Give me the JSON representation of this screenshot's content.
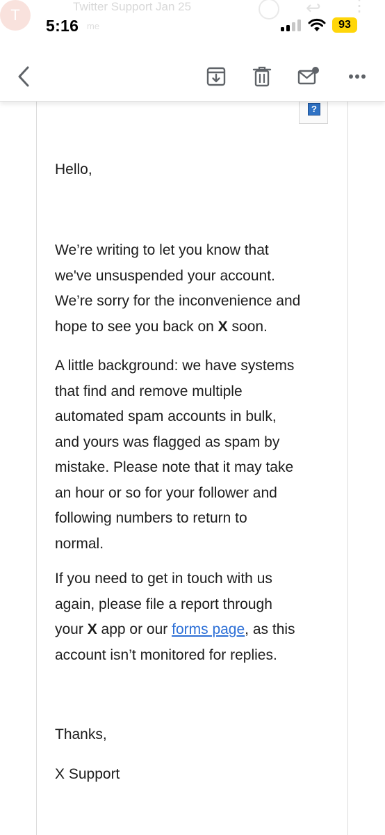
{
  "status_bar": {
    "time": "5:16",
    "battery": "93",
    "ghost_avatar_letter": "T",
    "ghost_sender": "Twitter Support  Jan 25",
    "ghost_to": "me"
  },
  "toolbar": {
    "icons": [
      "back-icon",
      "archive-icon",
      "trash-icon",
      "mark-unread-icon",
      "more-icon"
    ]
  },
  "email": {
    "greeting": "Hello,",
    "p1": {
      "line1": "We’re writing to let you know that",
      "line2": "we've unsuspended your account.",
      "line3": "We’re sorry for the inconvenience and",
      "line4_before": "hope to see you back on ",
      "x_logo": "X",
      "line4_after": " soon."
    },
    "p2": {
      "line1": "A little background: we have systems",
      "line2": "that find and remove multiple",
      "line3": "automated spam accounts in bulk,",
      "line4": "and yours was flagged as spam by",
      "line5": "mistake. Please note that it may take",
      "line6": "an hour or so for your follower and",
      "line7": "following numbers to return to",
      "line8": "normal."
    },
    "p3": {
      "line1": "If you need to get in touch with us",
      "line2": "again, please file a report through",
      "line3_before": "your ",
      "x_logo": "X",
      "line3_mid": " app or our ",
      "link_text": "forms page",
      "line3_after": ", as this",
      "line4": "account isn’t monitored for replies."
    },
    "thanks": "Thanks,",
    "signature": "X Support",
    "image_placeholder": "?"
  },
  "colors": {
    "link": "#2c6fd6",
    "battery": "#ffd60a",
    "icon_gray": "#5f6368"
  }
}
